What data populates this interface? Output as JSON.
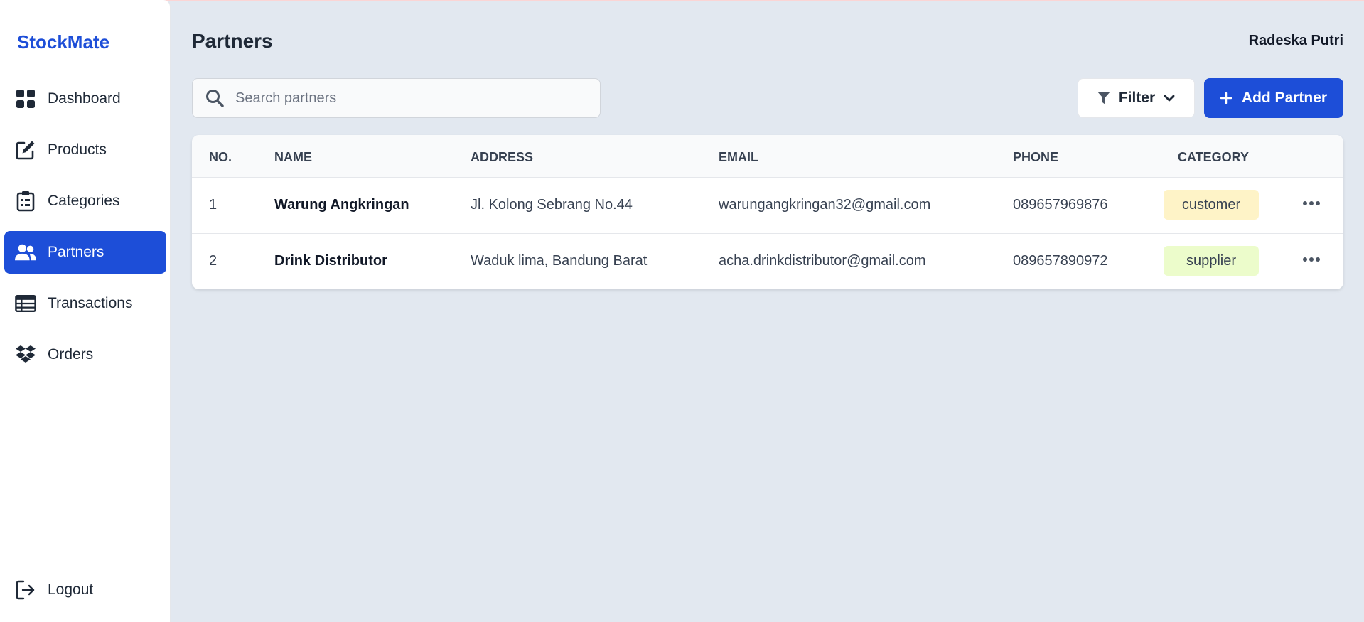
{
  "sidebar": {
    "brand": "StockMate",
    "items": [
      {
        "label": "Dashboard",
        "icon": "grid-icon"
      },
      {
        "label": "Products",
        "icon": "edit-icon"
      },
      {
        "label": "Categories",
        "icon": "clipboard-icon"
      },
      {
        "label": "Partners",
        "icon": "users-icon",
        "active": true
      },
      {
        "label": "Transactions",
        "icon": "table-icon"
      },
      {
        "label": "Orders",
        "icon": "dropbox-icon"
      }
    ],
    "logout_label": "Logout"
  },
  "header": {
    "title": "Partners",
    "user_name": "Radeska Putri"
  },
  "toolbar": {
    "search_placeholder": "Search partners",
    "filter_label": "Filter",
    "add_label": "Add Partner"
  },
  "table": {
    "columns": [
      "NO.",
      "NAME",
      "ADDRESS",
      "EMAIL",
      "PHONE",
      "CATEGORY"
    ],
    "rows": [
      {
        "no": "1",
        "name": "Warung Angkringan",
        "address": "Jl. Kolong Sebrang No.44",
        "email": "warungangkringan32@gmail.com",
        "phone": "089657969876",
        "category": "customer"
      },
      {
        "no": "2",
        "name": "Drink Distributor",
        "address": "Waduk lima, Bandung Barat",
        "email": "acha.drinkdistributor@gmail.com",
        "phone": "089657890972",
        "category": "supplier"
      }
    ]
  },
  "colors": {
    "accent": "#1d4ed8",
    "background": "#e2e8f0",
    "customer_badge": "#fef3c7",
    "supplier_badge": "#ecfccb"
  }
}
